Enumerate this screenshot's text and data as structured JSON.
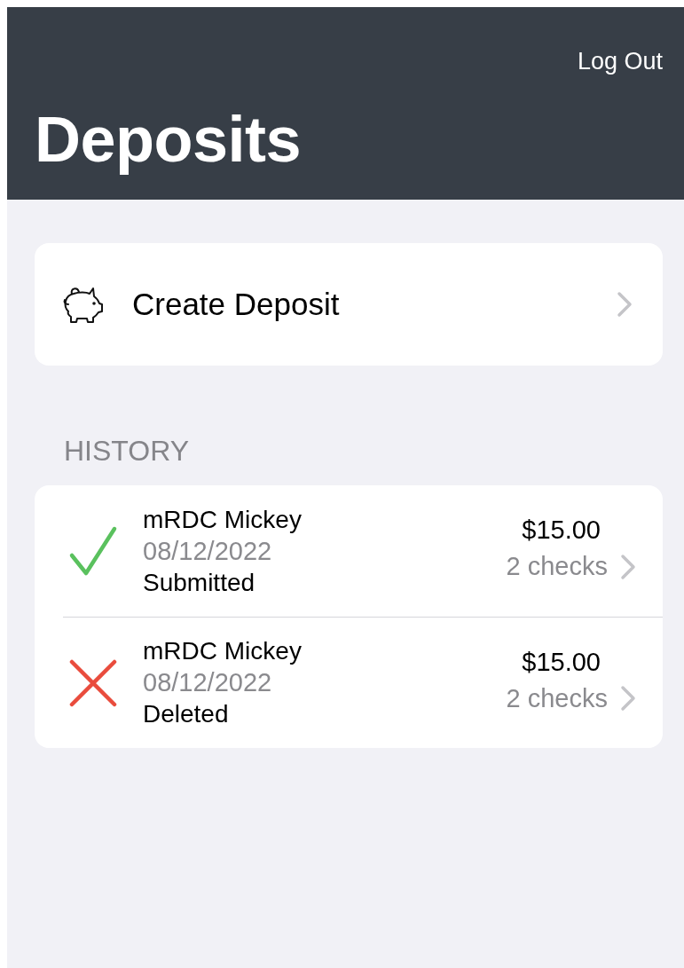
{
  "header": {
    "action": "Log Out",
    "title": "Deposits"
  },
  "create": {
    "label": "Create Deposit"
  },
  "history": {
    "heading": "HISTORY",
    "rows": [
      {
        "kind": "success",
        "name": "mRDC Mickey",
        "date": "08/12/2022",
        "status": "Submitted",
        "amount": "$15.00",
        "count": "2 checks"
      },
      {
        "kind": "failure",
        "name": "mRDC Mickey",
        "date": "08/12/2022",
        "status": "Deleted",
        "amount": "$15.00",
        "count": "2 checks"
      }
    ]
  }
}
